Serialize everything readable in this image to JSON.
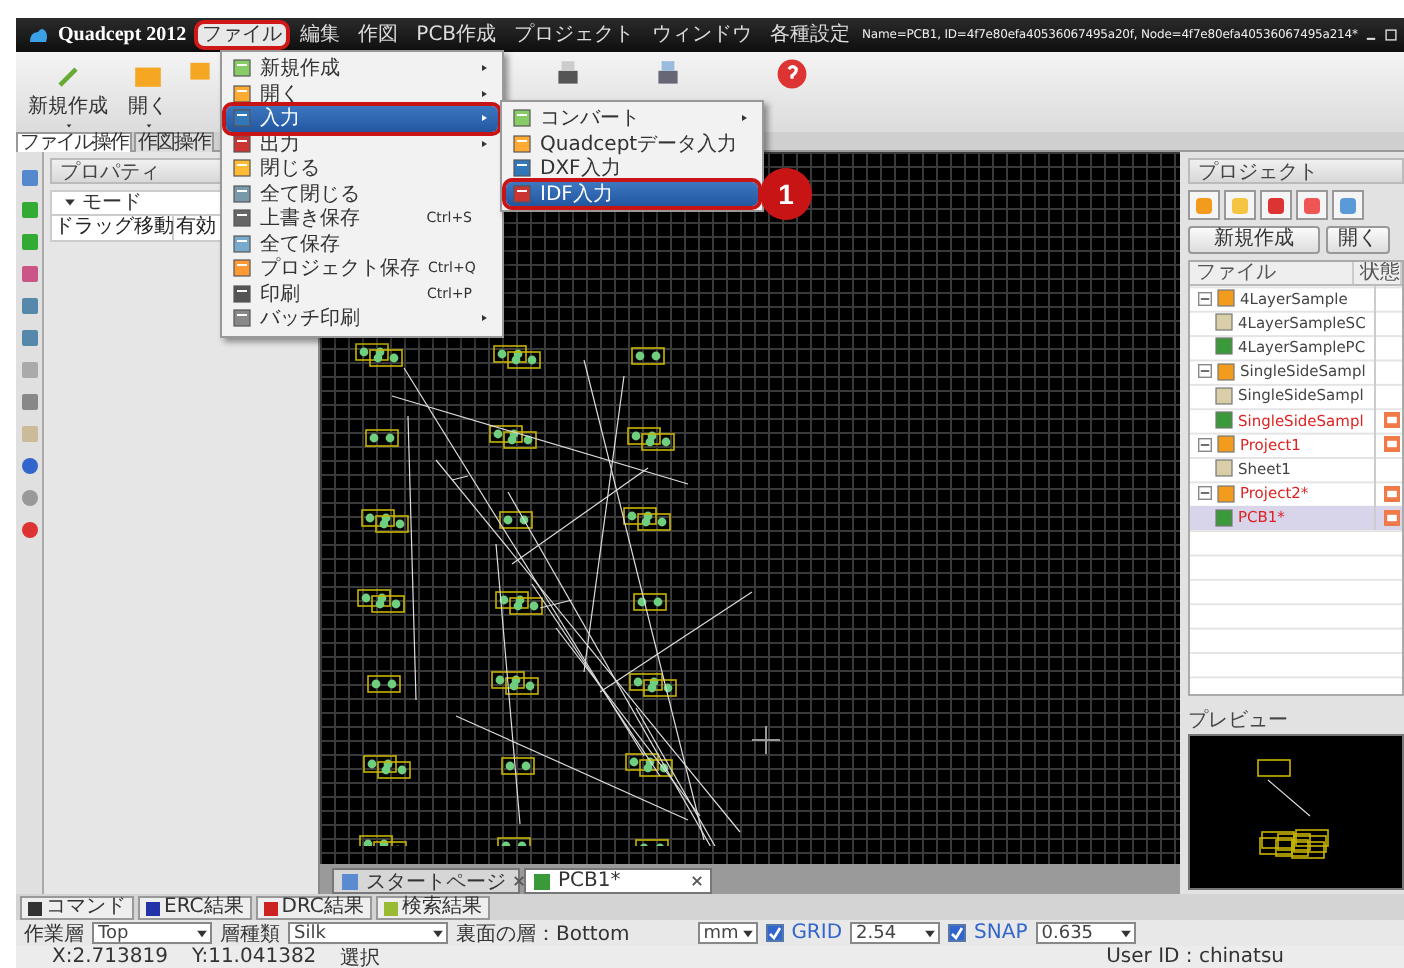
{
  "app": {
    "name": "Quadcept 2012"
  },
  "menu_bar": [
    {
      "label": "ファイル",
      "selected": true
    },
    {
      "label": "編集",
      "selected": false
    },
    {
      "label": "作図",
      "selected": false
    },
    {
      "label": "PCB作成",
      "selected": false
    },
    {
      "label": "プロジェクト",
      "selected": false
    },
    {
      "label": "ウィンドウ",
      "selected": false
    },
    {
      "label": "各種設定",
      "selected": false
    }
  ],
  "document_info": "Name=PCB1, ID=4f7e80efa40536067495a20f, Node=4f7e80efa40536067495a214*",
  "ribbon": {
    "buttons": [
      {
        "label": "新規作成"
      },
      {
        "label": "開く"
      }
    ],
    "tabs": [
      {
        "label": "ファイル操作",
        "selected": true
      },
      {
        "label": "作図操作",
        "selected": false
      }
    ]
  },
  "properties": {
    "title": "プロパティ",
    "group": "モード",
    "rows": [
      {
        "name": "ドラッグ移動",
        "value": "有効"
      }
    ]
  },
  "file_menu": [
    {
      "label": "新規作成",
      "submenu": true,
      "selected": false
    },
    {
      "label": "開く",
      "submenu": true,
      "selected": false
    },
    {
      "label": "入力",
      "submenu": true,
      "selected": true
    },
    {
      "label": "出力",
      "submenu": true,
      "selected": false
    },
    {
      "label": "閉じる",
      "submenu": false,
      "selected": false
    },
    {
      "label": "全て閉じる",
      "submenu": false,
      "selected": false
    },
    {
      "label": "上書き保存",
      "shortcut": "Ctrl+S",
      "submenu": false,
      "selected": false
    },
    {
      "label": "全て保存",
      "submenu": false,
      "selected": false
    },
    {
      "label": "プロジェクト保存",
      "shortcut": "Ctrl+Q",
      "submenu": false,
      "selected": false
    },
    {
      "label": "印刷",
      "shortcut": "Ctrl+P",
      "submenu": false,
      "selected": false
    },
    {
      "label": "バッチ印刷",
      "submenu": true,
      "selected": false
    }
  ],
  "input_submenu": [
    {
      "label": "コンバート",
      "submenu": true,
      "selected": false
    },
    {
      "label": "Quadceptデータ入力",
      "submenu": false,
      "selected": false
    },
    {
      "label": "DXF入力",
      "submenu": false,
      "selected": false
    },
    {
      "label": "IDF入力",
      "submenu": false,
      "selected": true
    }
  ],
  "callout": "1",
  "editor_tabs": [
    {
      "label": "スタートページ",
      "kind": "start",
      "selected": false
    },
    {
      "label": "PCB1*",
      "kind": "pcb",
      "selected": true
    }
  ],
  "project": {
    "title": "プロジェクト",
    "buttons": [
      "新規作成",
      "開く"
    ],
    "columns": [
      "ファイル",
      "状態"
    ],
    "tree": [
      {
        "name": "4LayerSample",
        "kind": "project",
        "expanded": true,
        "modified": false,
        "selected": false,
        "children": [
          {
            "name": "4LayerSampleSC",
            "kind": "schematic",
            "modified": false,
            "selected": false
          },
          {
            "name": "4LayerSamplePC",
            "kind": "pcb",
            "modified": false,
            "selected": false
          }
        ]
      },
      {
        "name": "SingleSideSampl",
        "kind": "project",
        "expanded": true,
        "modified": false,
        "selected": false,
        "children": [
          {
            "name": "SingleSideSampl",
            "kind": "schematic",
            "modified": false,
            "selected": false
          },
          {
            "name": "SingleSideSampl",
            "kind": "pcb",
            "modified": true,
            "selected": false
          }
        ]
      },
      {
        "name": "Project1",
        "kind": "project",
        "expanded": true,
        "modified": true,
        "selected": false,
        "children": [
          {
            "name": "Sheet1",
            "kind": "schematic",
            "modified": false,
            "selected": false
          }
        ]
      },
      {
        "name": "Project2*",
        "kind": "project",
        "expanded": true,
        "modified": true,
        "selected": false,
        "children": [
          {
            "name": "PCB1*",
            "kind": "pcb",
            "modified": true,
            "selected": true
          }
        ]
      }
    ]
  },
  "preview": {
    "title": "プレビュー"
  },
  "output_tabs": [
    {
      "label": "コマンド",
      "color": "#333333"
    },
    {
      "label": "ERC結果",
      "color": "#2233aa"
    },
    {
      "label": "DRC結果",
      "color": "#cc2222"
    },
    {
      "label": "検索結果",
      "color": "#99bb33"
    }
  ],
  "layer_bar": {
    "work_layer_label": "作業層",
    "work_layer": "Top",
    "layer_type_label": "層種類",
    "layer_type": "Silk",
    "back_layer": "裏面の層：Bottom",
    "unit": "mm",
    "grid": {
      "label": "GRID",
      "checked": true,
      "value": "2.54"
    },
    "snap": {
      "label": "SNAP",
      "checked": true,
      "value": "0.635"
    }
  },
  "status_bar": {
    "x": "X:2.713819",
    "y": "Y:11.041382",
    "mode": "選択",
    "user": "User ID : chinatsu"
  }
}
